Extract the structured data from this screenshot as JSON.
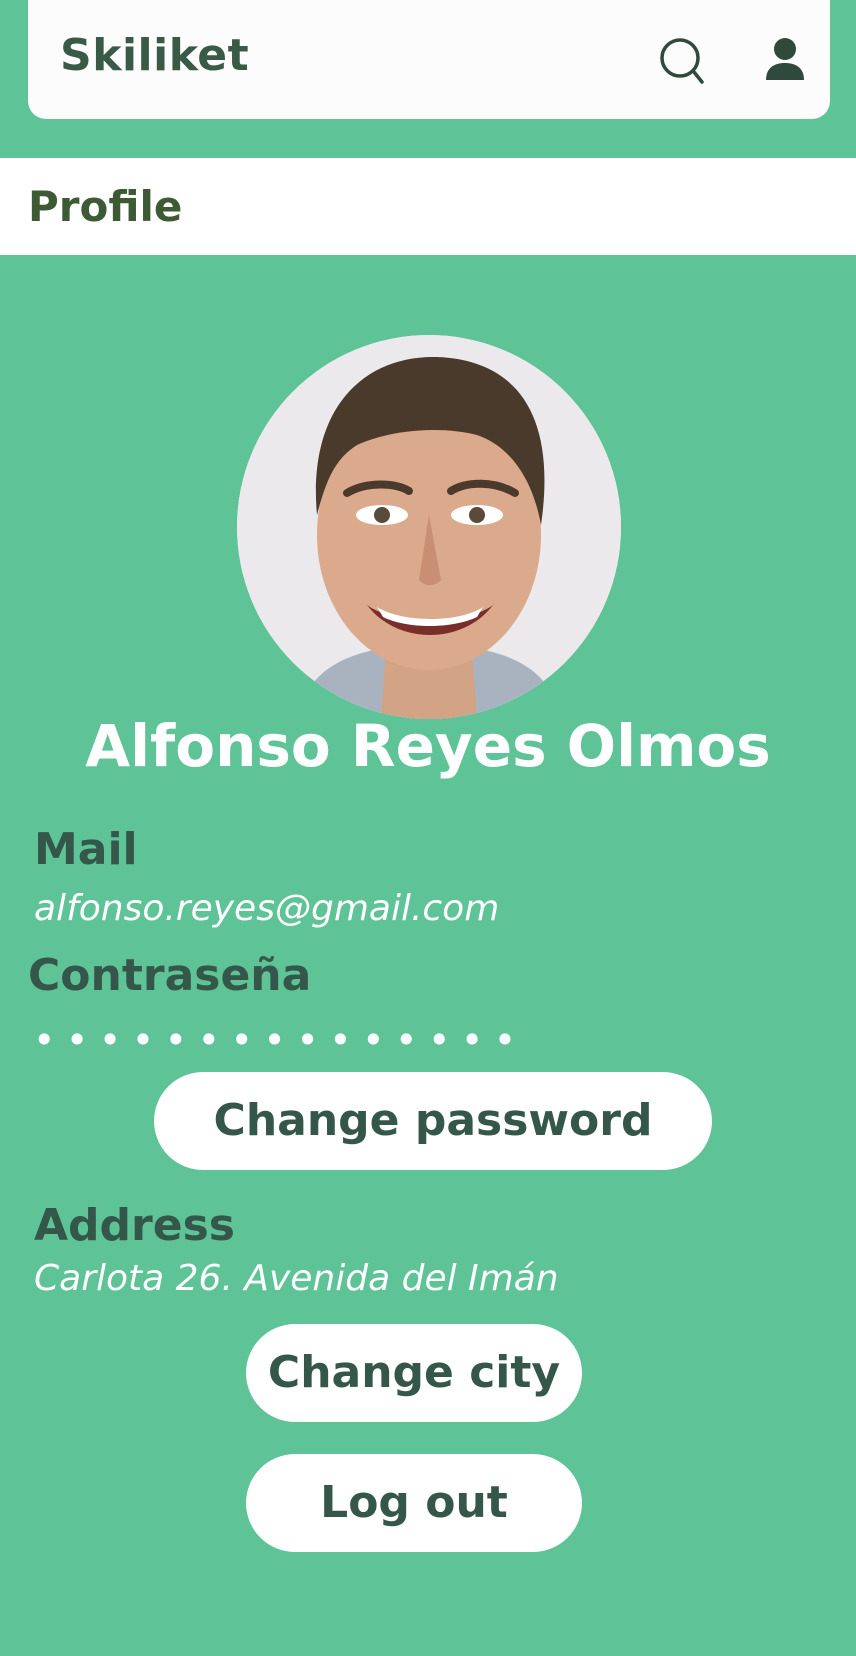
{
  "header": {
    "brand": "Skiliket",
    "search_icon": "search-icon",
    "user_icon": "user-icon"
  },
  "page": {
    "title": "Profile"
  },
  "profile": {
    "name": "Alfonso Reyes Olmos",
    "mail_label": "Mail",
    "mail_value": "alfonso.reyes@gmail.com",
    "password_label": "Contraseña",
    "password_mask": "•••••••••••••••",
    "change_password_label": "Change password",
    "address_label": "Address",
    "address_value": "Carlota 26. Avenida del Imán",
    "change_city_label": "Change city",
    "logout_label": "Log out"
  },
  "colors": {
    "background": "#5ec396",
    "text_dark": "#35574a",
    "white": "#ffffff"
  }
}
